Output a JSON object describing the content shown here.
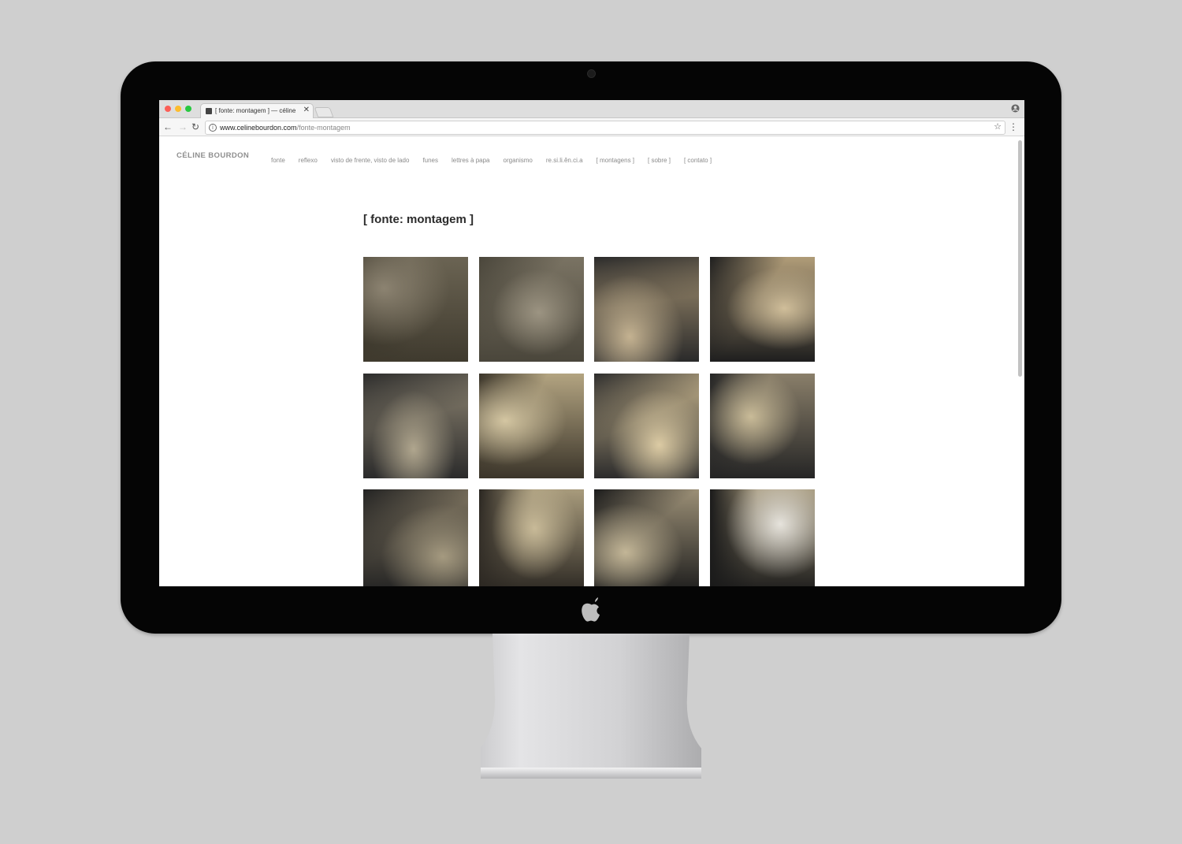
{
  "browser": {
    "tab_title": "[ fonte: montagem ] — céline bourdon",
    "tab_close": "✕",
    "url_domain": "www.celinebourdon.com",
    "url_path": "/fonte-montagem",
    "back_icon": "←",
    "forward_icon": "→",
    "reload_icon": "↻",
    "info_icon": "i",
    "star_icon": "☆",
    "menu_icon": "⋮"
  },
  "site": {
    "logo": "CÉLINE BOURDON",
    "nav": [
      "fonte",
      "reflexo",
      "visto de frente, visto de lado",
      "funes",
      "lettres à papa",
      "organismo",
      "re.si.li.ên.ci.a",
      "[ montagens ]",
      "[ sobre ]",
      "[ contato ]"
    ]
  },
  "page": {
    "title": "[ fonte: montagem ]"
  },
  "gallery": {
    "photos": [
      {
        "subject": "stone wall with moss",
        "palette": [
          "#6b6453",
          "#3f3a2e",
          "#8c8371"
        ]
      },
      {
        "subject": "ruined wall with window",
        "palette": [
          "#7a7363",
          "#4a463b",
          "#9c9482"
        ]
      },
      {
        "subject": "wooden crate with cables",
        "palette": [
          "#a89574",
          "#2a2a2a",
          "#c4b291"
        ]
      },
      {
        "subject": "crate full of black cables",
        "palette": [
          "#b09c78",
          "#1e1e1e",
          "#d0be9a"
        ]
      },
      {
        "subject": "wall with hanging cable bundle",
        "palette": [
          "#8e8572",
          "#2b2b2b",
          "#b0a68e"
        ]
      },
      {
        "subject": "wall corner with cable",
        "palette": [
          "#b3a481",
          "#3b352a",
          "#d4c6a2"
        ]
      },
      {
        "subject": "wall with cables on floor",
        "palette": [
          "#c2b08a",
          "#2c2c2c",
          "#dccba4"
        ]
      },
      {
        "subject": "shaft with steel beam",
        "palette": [
          "#8a7f6a",
          "#252525",
          "#c9bb98"
        ]
      },
      {
        "subject": "scaffolding against wall",
        "palette": [
          "#7d735f",
          "#222222",
          "#a59a80"
        ]
      },
      {
        "subject": "worker on wall with cables",
        "palette": [
          "#a89b7c",
          "#2a2621",
          "#c8ba98"
        ]
      },
      {
        "subject": "worker standing in cable pile",
        "palette": [
          "#9b8f76",
          "#1b1b1b",
          "#c3b697"
        ]
      },
      {
        "subject": "worker in cable pile with sheet",
        "palette": [
          "#a39679",
          "#1a1a1a",
          "#e6e3dc"
        ]
      }
    ]
  }
}
